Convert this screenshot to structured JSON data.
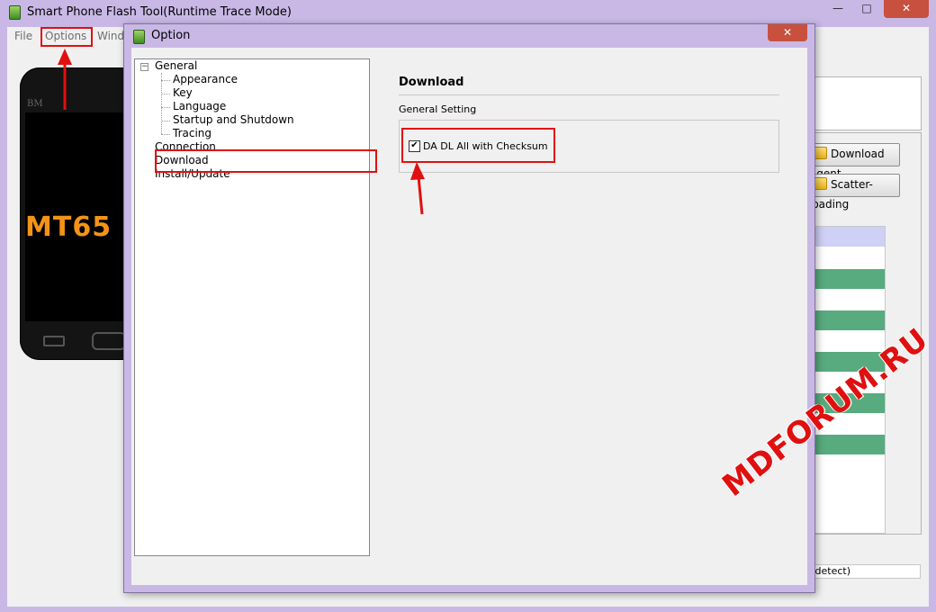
{
  "main_window": {
    "title": "Smart Phone Flash Tool(Runtime Trace Mode)",
    "controls": {
      "minimize": "—",
      "maximize": "□",
      "close": "✕"
    },
    "menu": [
      "File",
      "Options",
      "Wind"
    ],
    "phone": {
      "brand": "BM",
      "model_text": "MT65"
    },
    "buttons": {
      "download_agent": "Download Agent",
      "scatter_loading": "Scatter-loading"
    },
    "status_text": "to detect)",
    "row_color": "#58ab7e",
    "header_color": "#cfd0f5"
  },
  "dialog": {
    "title": "Option",
    "close_label": "✕",
    "tree": {
      "general": "General",
      "general_children": [
        "Appearance",
        "Key",
        "Language",
        "Startup and Shutdown",
        "Tracing"
      ],
      "connection": "Connection",
      "download": "Download",
      "install_update": "Install/Update"
    },
    "page": {
      "title": "Download",
      "group_label": "General Setting",
      "checkbox_label": "DA DL All with Checksum",
      "checkbox_checked": true,
      "check_glyph": "✔"
    }
  },
  "watermark": "MDFORUM.RU",
  "annotation_color": "#e01010"
}
